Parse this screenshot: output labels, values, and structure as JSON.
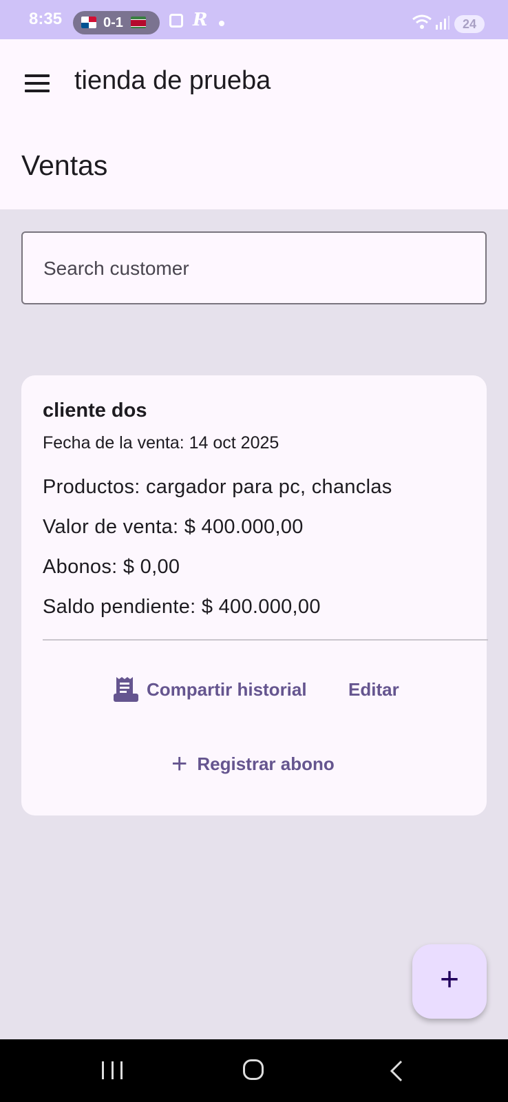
{
  "status_bar": {
    "time": "8:35",
    "score": "0-1",
    "battery": "24",
    "icons": [
      "screenshot-icon",
      "r-app-icon",
      "notification-dot",
      "wifi-icon",
      "signal-icon"
    ]
  },
  "app_bar": {
    "title": "tienda de prueba",
    "menu_icon": "hamburger-menu-icon"
  },
  "page": {
    "title": "Ventas"
  },
  "search": {
    "placeholder": "Search customer",
    "value": ""
  },
  "sales": [
    {
      "customer": "cliente dos",
      "date_line": "Fecha de la venta: 14 oct 2025",
      "products_line": "Productos: cargador para pc, chanclas",
      "value_line": "Valor de venta: $ 400.000,00",
      "payments_line": "Abonos: $ 0,00",
      "balance_line": "Saldo pendiente: $ 400.000,00",
      "share_label": "Compartir historial",
      "edit_label": "Editar",
      "register_label": "Registrar abono"
    }
  ],
  "fab": {
    "label": "+"
  },
  "colors": {
    "primary": "#65558f",
    "surface": "#fef7ff",
    "background": "#e6e1ec",
    "fab": "#eaddff",
    "status_bar": "#cfc2f8"
  }
}
